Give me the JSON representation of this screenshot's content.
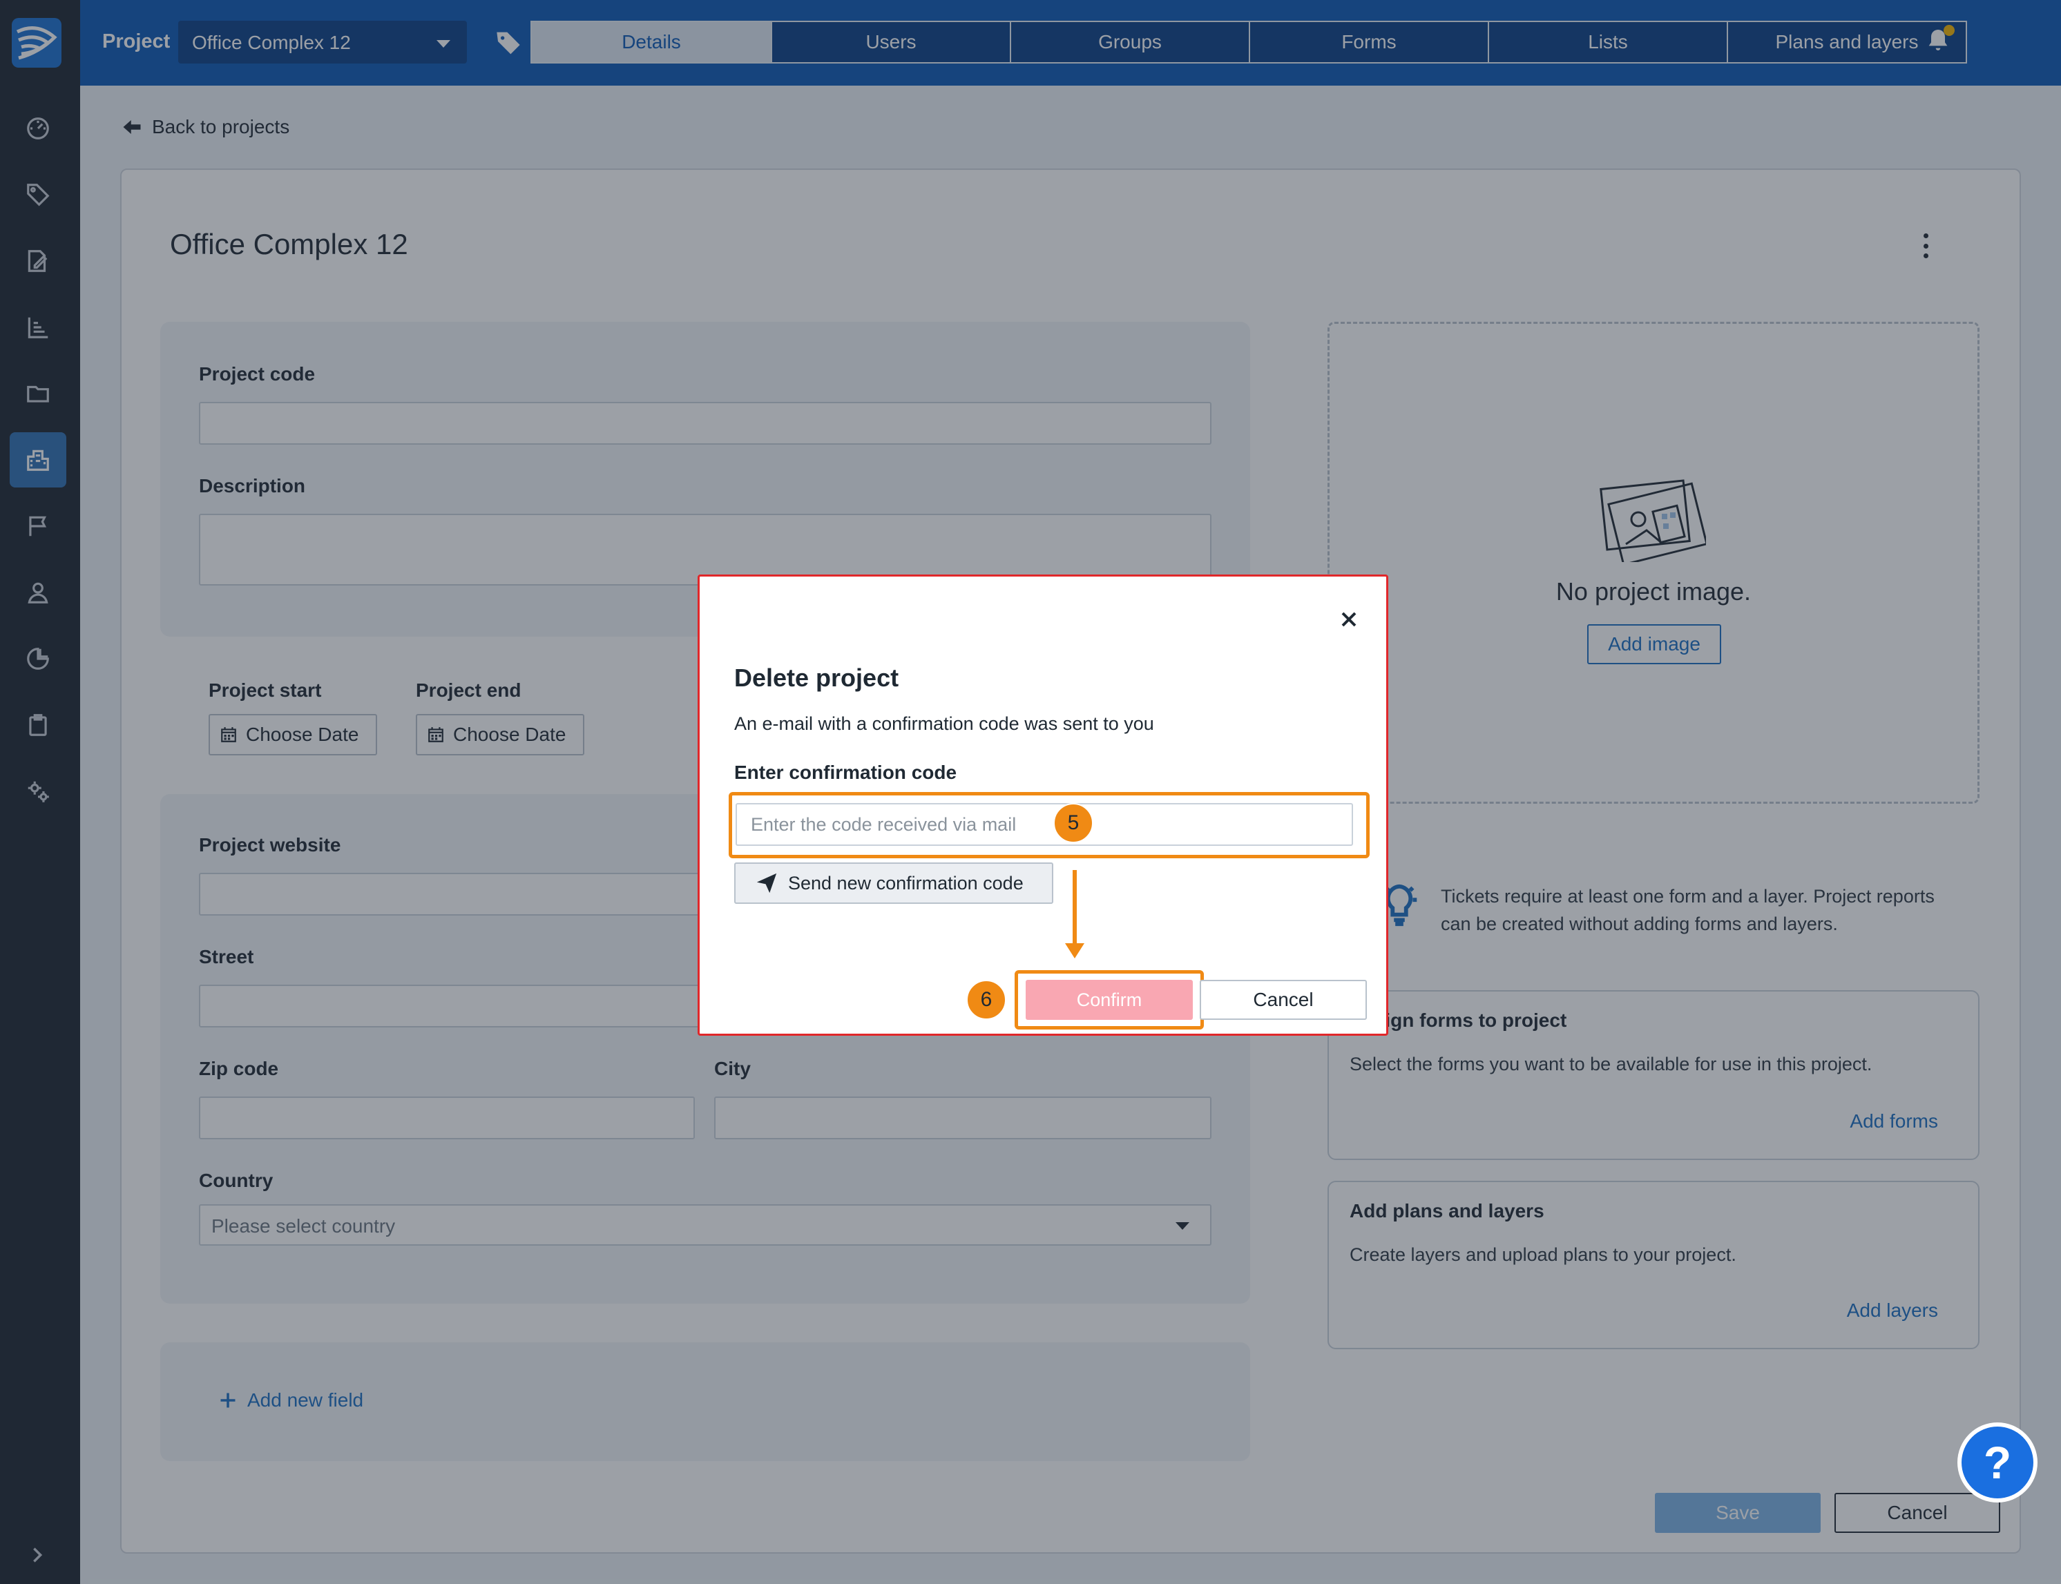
{
  "topbar": {
    "project_label": "Project",
    "project_selected": "Office Complex 12",
    "tabs": [
      {
        "label": "Details",
        "active": true
      },
      {
        "label": "Users"
      },
      {
        "label": "Groups"
      },
      {
        "label": "Forms"
      },
      {
        "label": "Lists"
      },
      {
        "label": "Plans and layers"
      }
    ]
  },
  "sidebar": {
    "icons": [
      "dashboard-icon",
      "tags-icon",
      "edit-document-icon",
      "chart-icon",
      "folder-icon",
      "buildings-icon",
      "flag-icon",
      "user-icon",
      "pie-chart-icon",
      "clipboard-icon",
      "settings-icon"
    ],
    "active": "buildings-icon"
  },
  "page": {
    "back_link": "Back to projects",
    "title": "Office Complex 12"
  },
  "form": {
    "project_code_label": "Project code",
    "description_label": "Description",
    "project_start_label": "Project start",
    "project_end_label": "Project end",
    "choose_date": "Choose Date",
    "website_label": "Project website",
    "street_label": "Street",
    "zip_label": "Zip code",
    "city_label": "City",
    "country_label": "Country",
    "country_placeholder": "Please select country",
    "add_field": "Add new field"
  },
  "image_panel": {
    "no_image_text": "No project image.",
    "add_image": "Add image"
  },
  "hint": "Tickets require at least one form and a layer. Project reports can be created without adding forms and layers.",
  "cards": [
    {
      "title": "Assign forms to project",
      "desc": "Select the forms you want to be available for use in this project.",
      "link": "Add forms"
    },
    {
      "title": "Add plans and layers",
      "desc": "Create layers and upload plans to your project.",
      "link": "Add layers"
    }
  ],
  "footer": {
    "save": "Save",
    "cancel": "Cancel"
  },
  "help": "?",
  "modal": {
    "title": "Delete project",
    "message": "An e-mail with a confirmation code was sent to you",
    "code_label": "Enter confirmation code",
    "code_placeholder": "Enter the code received via mail",
    "send_new": "Send new confirmation code",
    "confirm": "Confirm",
    "cancel": "Cancel",
    "step_input": "5",
    "step_confirm": "6"
  },
  "colors": {
    "topbar": "#0b58b4",
    "sidebar": "#1d2531",
    "highlight": "#f08a14",
    "modal_border": "#e1272a",
    "confirm_disabled": "#f9a7b2"
  }
}
